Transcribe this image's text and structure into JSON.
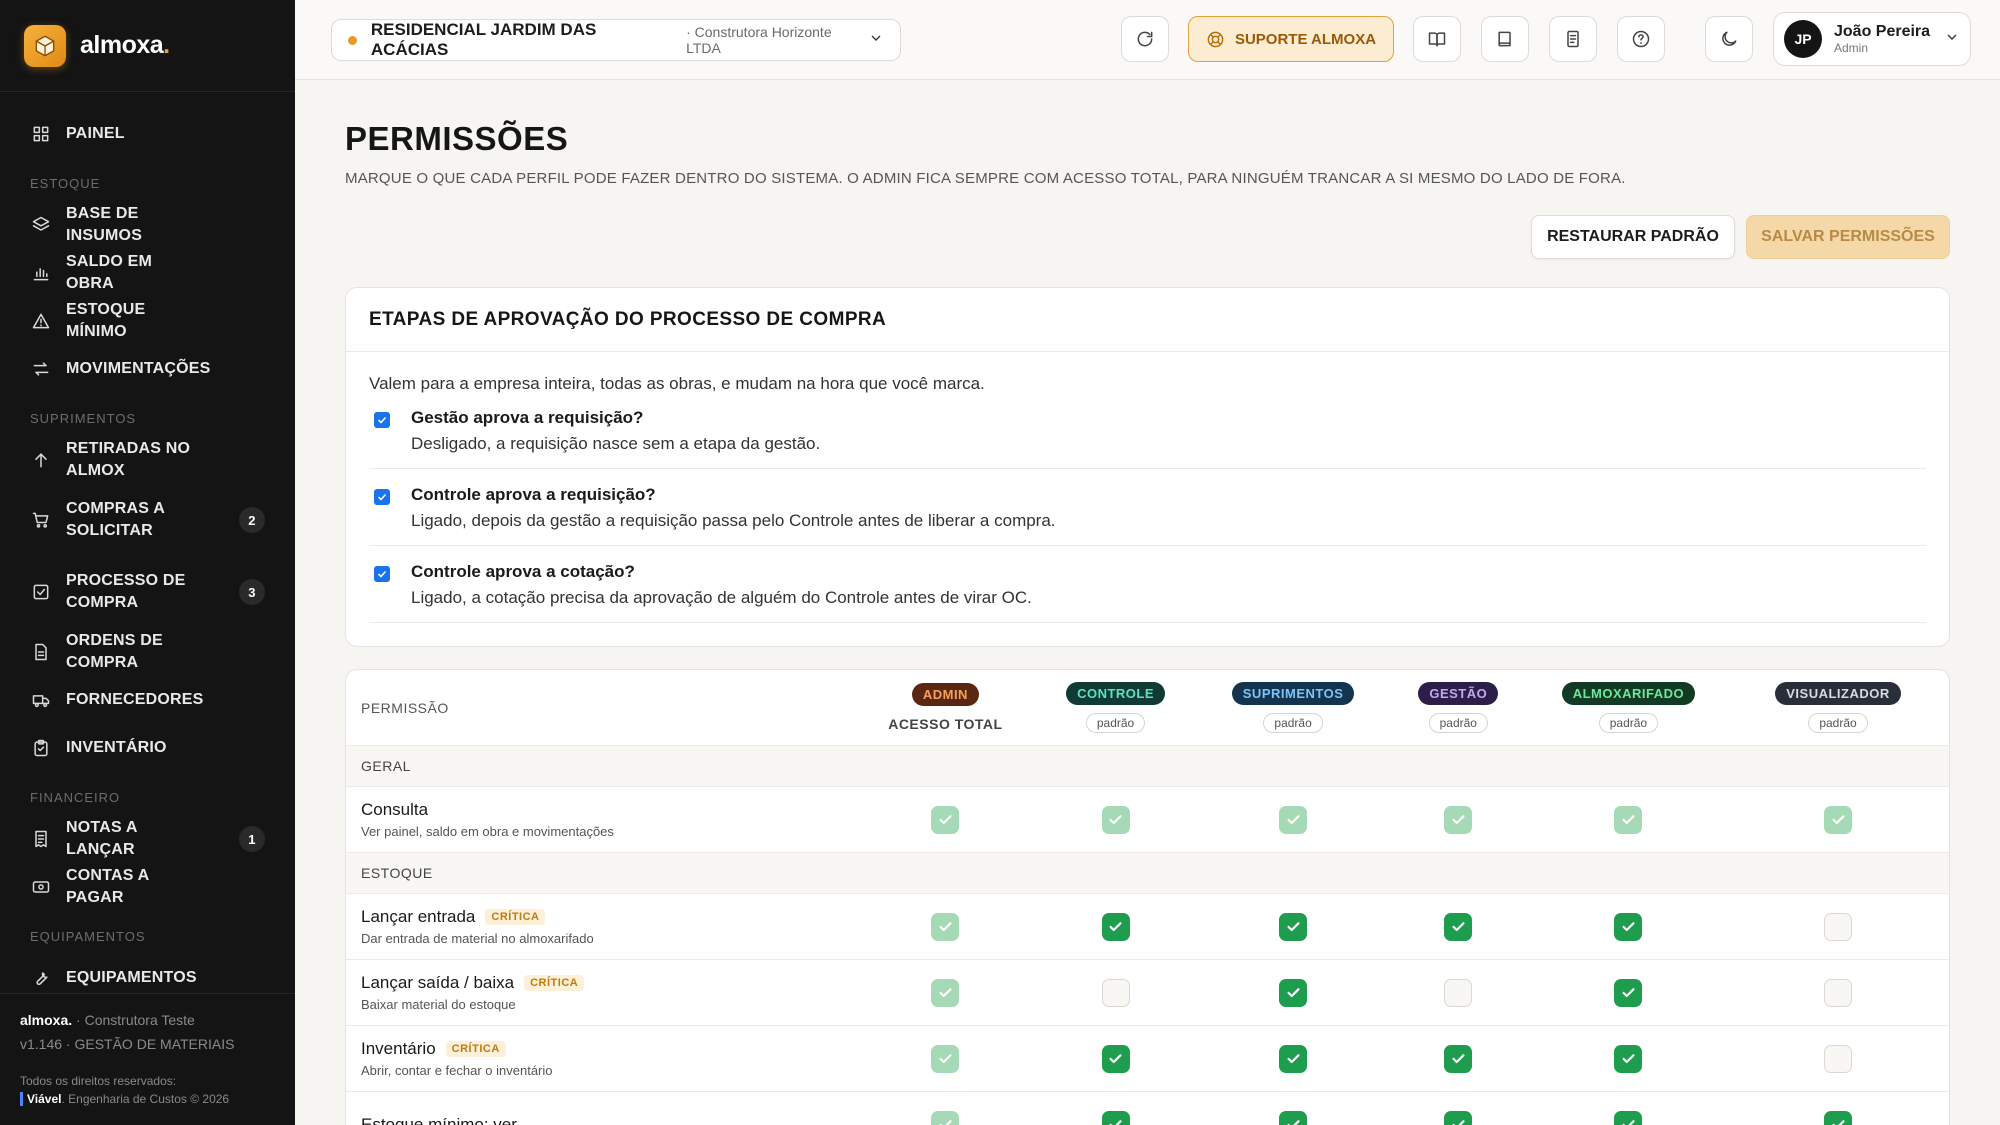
{
  "brand": {
    "name": "almoxa",
    "dot": "."
  },
  "sidebar": {
    "items": [
      {
        "type": "item",
        "label": "PAINEL",
        "icon": "grid-icon",
        "name": "sidebar-item-painel"
      },
      {
        "type": "section",
        "label": "ESTOQUE"
      },
      {
        "type": "item",
        "label": "BASE DE INSUMOS",
        "icon": "layers-icon",
        "name": "sidebar-item-base-de-insumos"
      },
      {
        "type": "item",
        "label": "SALDO EM OBRA",
        "icon": "bar-chart-icon",
        "name": "sidebar-item-saldo-em-obra"
      },
      {
        "type": "item",
        "label": "ESTOQUE MÍNIMO",
        "icon": "alert-triangle-icon",
        "name": "sidebar-item-estoque-minimo"
      },
      {
        "type": "item",
        "label": "MOVIMENTAÇÕES",
        "icon": "arrows-swap-icon",
        "name": "sidebar-item-movimentacoes"
      },
      {
        "type": "section",
        "label": "SUPRIMENTOS"
      },
      {
        "type": "item",
        "label": "RETIRADAS NO ALMOX",
        "icon": "arrow-up-icon",
        "name": "sidebar-item-retiradas"
      },
      {
        "type": "item",
        "label": "COMPRAS A SOLICITAR",
        "icon": "cart-icon",
        "badge": "2",
        "tall": true,
        "name": "sidebar-item-compras-a-solicitar"
      },
      {
        "type": "item",
        "label": "PROCESSO DE COMPRA",
        "icon": "check-square-icon",
        "badge": "3",
        "tall": true,
        "name": "sidebar-item-processo-de-compra"
      },
      {
        "type": "item",
        "label": "ORDENS DE COMPRA",
        "icon": "file-icon",
        "name": "sidebar-item-ordens-de-compra"
      },
      {
        "type": "item",
        "label": "FORNECEDORES",
        "icon": "truck-icon",
        "name": "sidebar-item-fornecedores"
      },
      {
        "type": "item",
        "label": "INVENTÁRIO",
        "icon": "clipboard-icon",
        "name": "sidebar-item-inventario"
      },
      {
        "type": "section",
        "label": "FINANCEIRO"
      },
      {
        "type": "item",
        "label": "NOTAS A LANÇAR",
        "icon": "receipt-icon",
        "badge": "1",
        "name": "sidebar-item-notas-a-lancar"
      },
      {
        "type": "item",
        "label": "CONTAS A PAGAR",
        "icon": "banknote-icon",
        "name": "sidebar-item-contas-a-pagar"
      },
      {
        "type": "section",
        "label": "EQUIPAMENTOS"
      },
      {
        "type": "item",
        "label": "EQUIPAMENTOS",
        "icon": "wrench-icon",
        "name": "sidebar-item-equipamentos"
      }
    ],
    "footer": {
      "brand": "almoxa.",
      "company": " · Construtora Teste",
      "version": "v1.146 · GESTÃO DE MATERIAIS",
      "rights": "Todos os direitos reservados:",
      "credit_brand": "Viável",
      "credit_rest": ". Engenharia de Custos © 2026"
    }
  },
  "topbar": {
    "project_name": "RESIDENCIAL JARDIM DAS ACÁCIAS",
    "project_company": "· Construtora Horizonte LTDA",
    "support_label": "SUPORTE ALMOXA",
    "user_initials": "JP",
    "user_name": "João Pereira",
    "user_role": "Admin"
  },
  "page": {
    "title": "PERMISSÕES",
    "description": "MARQUE O QUE CADA PERFIL PODE FAZER DENTRO DO SISTEMA. O ADMIN FICA SEMPRE COM ACESSO TOTAL, PARA NINGUÉM TRANCAR A SI MESMO DO LADO DE FORA.",
    "restore_label": "RESTAURAR PADRÃO",
    "save_label": "SALVAR PERMISSÕES"
  },
  "approval": {
    "title": "ETAPAS DE APROVAÇÃO DO PROCESSO DE COMPRA",
    "intro": "Valem para a empresa inteira, todas as obras, e mudam na hora que você marca.",
    "options": [
      {
        "title": "Gestão aprova a requisição?",
        "desc": "Desligado, a requisição nasce sem a etapa da gestão.",
        "checked": true
      },
      {
        "title": "Controle aprova a requisição?",
        "desc": "Ligado, depois da gestão a requisição passa pelo Controle antes de liberar a compra.",
        "checked": true
      },
      {
        "title": "Controle aprova a cotação?",
        "desc": "Ligado, a cotação precisa da aprovação de alguém do Controle antes de virar OC.",
        "checked": true
      }
    ]
  },
  "permissions": {
    "header_label": "PERMISSÃO",
    "roles": [
      {
        "label": "ADMIN",
        "sub": "ACESSO TOTAL",
        "bg": "#5a2712",
        "fg": "#f6a15a"
      },
      {
        "label": "CONTROLE",
        "sub": "padrão",
        "bg": "#0f3b34",
        "fg": "#5ee0c6"
      },
      {
        "label": "SUPRIMENTOS",
        "sub": "padrão",
        "bg": "#14334e",
        "fg": "#7cc4f5"
      },
      {
        "label": "GESTÃO",
        "sub": "padrão",
        "bg": "#2c1f47",
        "fg": "#c4a6f5"
      },
      {
        "label": "ALMOXARIFADO",
        "sub": "padrão",
        "bg": "#133a22",
        "fg": "#6ee89a"
      },
      {
        "label": "VISUALIZADOR",
        "sub": "padrão",
        "bg": "#2a2e38",
        "fg": "#d6dae2"
      }
    ],
    "rows": [
      {
        "type": "group",
        "label": "GERAL"
      },
      {
        "type": "perm",
        "title": "Consulta",
        "desc": "Ver painel, saldo em obra e movimentações",
        "critical": false,
        "values": [
          "light",
          "light",
          "light",
          "light",
          "light",
          "light"
        ]
      },
      {
        "type": "group",
        "label": "ESTOQUE"
      },
      {
        "type": "perm",
        "title": "Lançar entrada",
        "desc": "Dar entrada de material no almoxarifado",
        "critical": true,
        "values": [
          "light",
          "on",
          "on",
          "on",
          "on",
          "off"
        ]
      },
      {
        "type": "perm",
        "title": "Lançar saída / baixa",
        "desc": "Baixar material do estoque",
        "critical": true,
        "values": [
          "light",
          "off",
          "on",
          "off",
          "on",
          "off"
        ]
      },
      {
        "type": "perm",
        "title": "Inventário",
        "desc": "Abrir, contar e fechar o inventário",
        "critical": true,
        "values": [
          "light",
          "on",
          "on",
          "on",
          "on",
          "off"
        ]
      },
      {
        "type": "perm",
        "title": "Estoque mínimo: ver",
        "desc": "",
        "critical": false,
        "values": [
          "light",
          "on",
          "on",
          "on",
          "on",
          "on"
        ]
      }
    ],
    "critical_label": "CRÍTICA"
  }
}
